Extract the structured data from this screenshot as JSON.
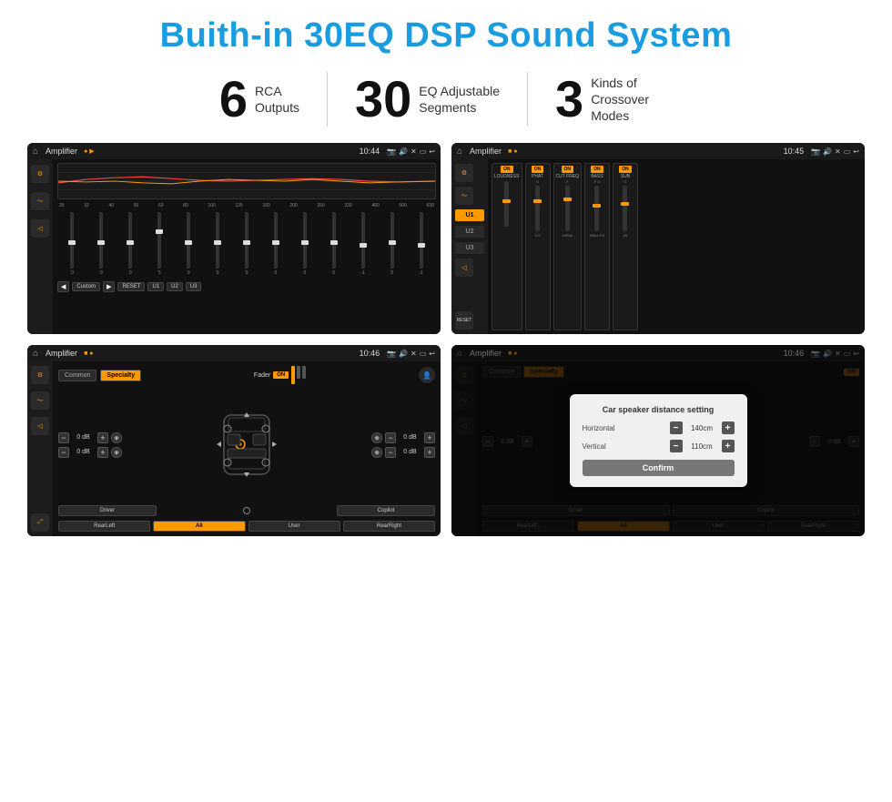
{
  "page": {
    "title": "Buith-in 30EQ DSP Sound System",
    "stats": [
      {
        "number": "6",
        "label": "RCA\nOutputs"
      },
      {
        "number": "30",
        "label": "EQ Adjustable\nSegments"
      },
      {
        "number": "3",
        "label": "Kinds of\nCrossover Modes"
      }
    ]
  },
  "screens": {
    "eq_screen": {
      "status": {
        "app": "Amplifier",
        "dots": "● ▶",
        "time": "10:44"
      },
      "freq_labels": [
        "25",
        "32",
        "40",
        "50",
        "63",
        "80",
        "100",
        "125",
        "160",
        "200",
        "250",
        "320",
        "400",
        "500",
        "630"
      ],
      "slider_values": [
        "0",
        "0",
        "0",
        "5",
        "0",
        "0",
        "0",
        "0",
        "0",
        "0",
        "-1",
        "0",
        "-1"
      ],
      "buttons": [
        "Custom",
        "RESET",
        "U1",
        "U2",
        "U3"
      ]
    },
    "amp_screen": {
      "status": {
        "app": "Amplifier",
        "dots": "■ ●",
        "time": "10:45"
      },
      "presets": [
        "U1",
        "U2",
        "U3"
      ],
      "modules": [
        {
          "label": "LOUDNESS",
          "on": true
        },
        {
          "label": "PHAT",
          "on": true
        },
        {
          "label": "CUT FREQ",
          "on": true
        },
        {
          "label": "BASS",
          "on": true
        },
        {
          "label": "SUB",
          "on": true
        }
      ],
      "reset_label": "RESET"
    },
    "fader_screen": {
      "status": {
        "app": "Amplifier",
        "dots": "■ ●",
        "time": "10:46"
      },
      "tabs": [
        "Common",
        "Specialty"
      ],
      "active_tab": "Specialty",
      "fader_label": "Fader",
      "fader_on": "ON",
      "db_values": [
        "0 dB",
        "0 dB",
        "0 dB",
        "0 dB"
      ],
      "buttons": [
        "Driver",
        "Copilot",
        "RearLeft",
        "All",
        "User",
        "RearRight"
      ]
    },
    "dialog_screen": {
      "status": {
        "app": "Amplifier",
        "dots": "■ ●",
        "time": "10:46"
      },
      "tabs": [
        "Common",
        "Specialty"
      ],
      "dialog": {
        "title": "Car speaker distance setting",
        "horizontal_label": "Horizontal",
        "horizontal_value": "140cm",
        "vertical_label": "Vertical",
        "vertical_value": "110cm",
        "confirm_label": "Confirm"
      },
      "db_values": [
        "0 dB",
        "0 dB"
      ],
      "buttons": [
        "Driver",
        "Copilot",
        "RearLef...",
        "All",
        "User",
        "RearRight"
      ]
    }
  }
}
